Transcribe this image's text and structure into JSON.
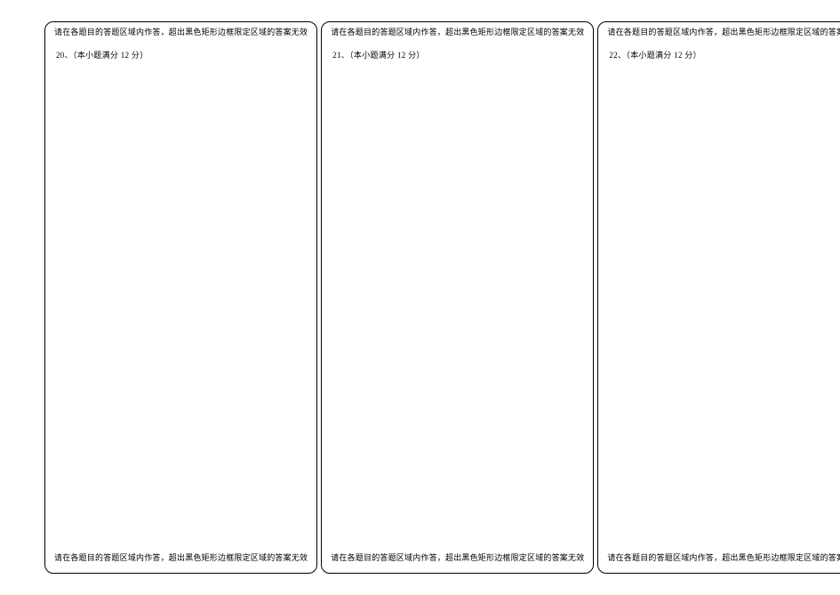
{
  "boundary_text": "请在各题目的答题区域内作答，超出黑色矩形边框限定区域的答案无效",
  "columns": [
    {
      "question_label": "20、（本小题满分 12 分）"
    },
    {
      "question_label": "21、（本小题满分 12 分）"
    },
    {
      "question_label": "22、（本小题满分 12 分）"
    }
  ]
}
